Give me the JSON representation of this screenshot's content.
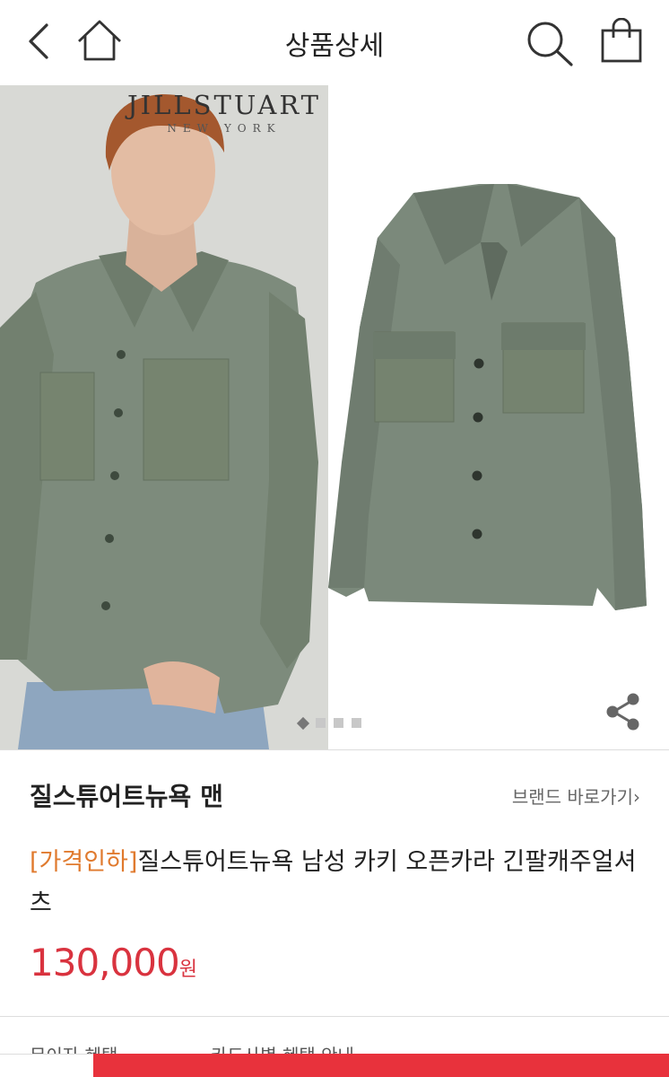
{
  "header": {
    "title": "상품상세",
    "icons": [
      "back-arrow-icon",
      "home-icon",
      "search-icon",
      "shopping-bag-icon"
    ]
  },
  "gallery": {
    "brand_logo_line1": "JILLSTUART",
    "brand_logo_line2": "NEW YORK",
    "image_count": 4,
    "active_index": 1,
    "colors": {
      "shirt": "#7c8a7c",
      "background": "#d7d8d4"
    }
  },
  "product": {
    "brand": "질스튜어트뉴욕 맨",
    "brand_link": "브랜드 바로가기",
    "tag": "[가격인하]",
    "title": "질스튜어트뉴욕 남성 카키 오픈카라 긴팔캐주얼셔츠",
    "price": "130,000",
    "currency": "원"
  },
  "benefits": {
    "label": "무이자 혜택",
    "value": "카드사별 혜택 안내"
  },
  "colors": {
    "accent": "#d9333f",
    "tag": "#e07a2e",
    "buy_bar": "#e8323c"
  }
}
